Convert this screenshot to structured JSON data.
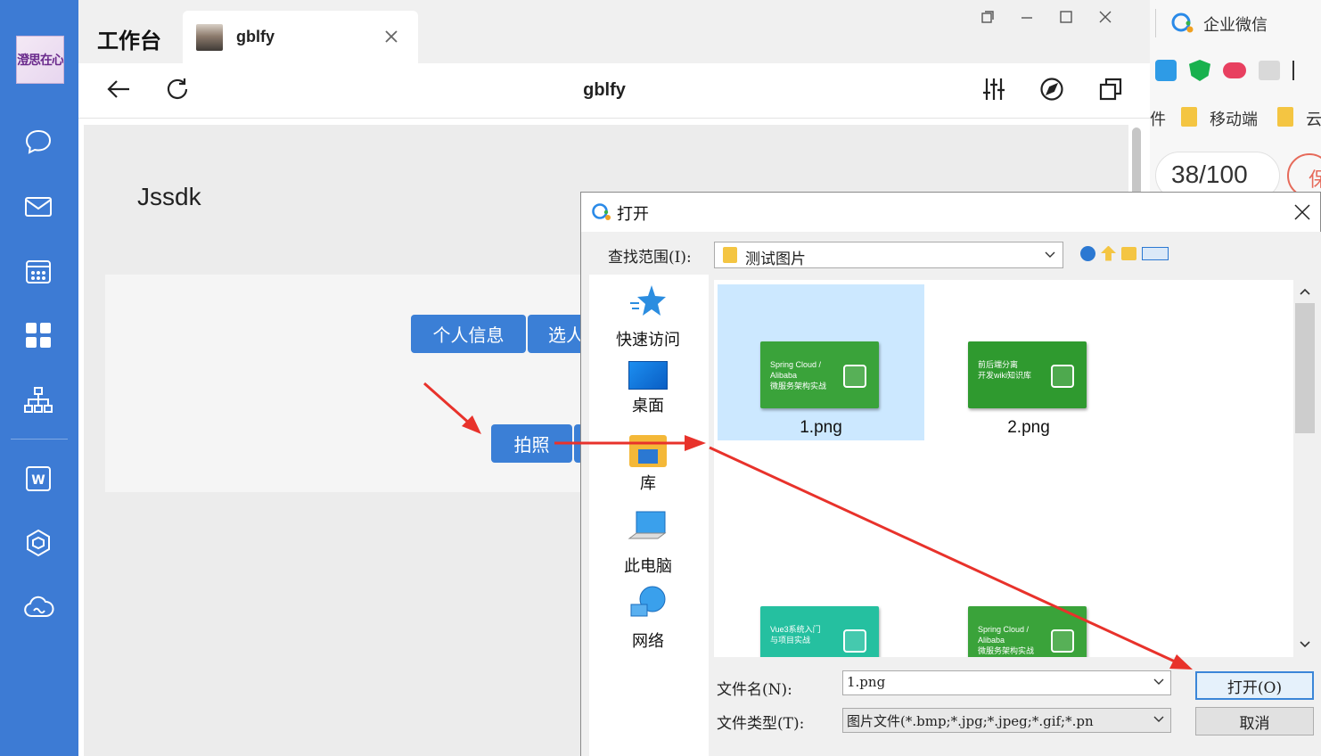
{
  "rail": {
    "avatar_text": "澄思在心",
    "items": [
      "chat-icon",
      "mail-icon",
      "calendar-icon",
      "workbench-icon",
      "org-icon",
      "doc-icon",
      "cube-icon",
      "cloud-icon"
    ]
  },
  "window": {
    "app_title": "工作台",
    "tab_label": "gblfy",
    "page_title": "gblfy"
  },
  "content": {
    "heading": "Jssdk",
    "btn_profile": "个人信息",
    "btn_select": "选人",
    "btn_photo": "拍照"
  },
  "background_app": {
    "wecom_label": "企业微信",
    "bookmark_partial": "件",
    "bookmark_mobile": "移动端",
    "bookmark_cloud": "云",
    "score": "38/100",
    "badge_partial": "保"
  },
  "dialog": {
    "title": "打开",
    "lookin_label": "查找范围(I):",
    "lookin_value": "测试图片",
    "places": [
      "快速访问",
      "桌面",
      "库",
      "此电脑",
      "网络"
    ],
    "files": [
      {
        "name": "1.png",
        "selected": true,
        "lines": [
          "Spring Cloud /",
          "Alibaba",
          "微服务架构实战"
        ],
        "color": "#3aa33a"
      },
      {
        "name": "2.png",
        "selected": false,
        "lines": [
          "前后端分离",
          "开发wiki知识库"
        ],
        "color": "#2f9a2f"
      },
      {
        "name": "",
        "selected": false,
        "lines": [
          "Vue3系统入门",
          "与项目实战"
        ],
        "color": "#25c0a0"
      },
      {
        "name": "",
        "selected": false,
        "lines": [
          "Spring Cloud /",
          "Alibaba",
          "微服务架构实战"
        ],
        "color": "#3aa33a"
      }
    ],
    "filename_label": "文件名(N):",
    "filename_value": "1.png",
    "filetype_label": "文件类型(T):",
    "filetype_value": "图片文件(*.bmp;*.jpg;*.jpeg;*.gif;*.pn",
    "open_button": "打开(O)",
    "cancel_button": "取消"
  },
  "colors": {
    "rail": "#3d7bd4",
    "primary_button": "#3b7fd6",
    "arrow": "#e8322b",
    "selection": "#cce8ff"
  }
}
